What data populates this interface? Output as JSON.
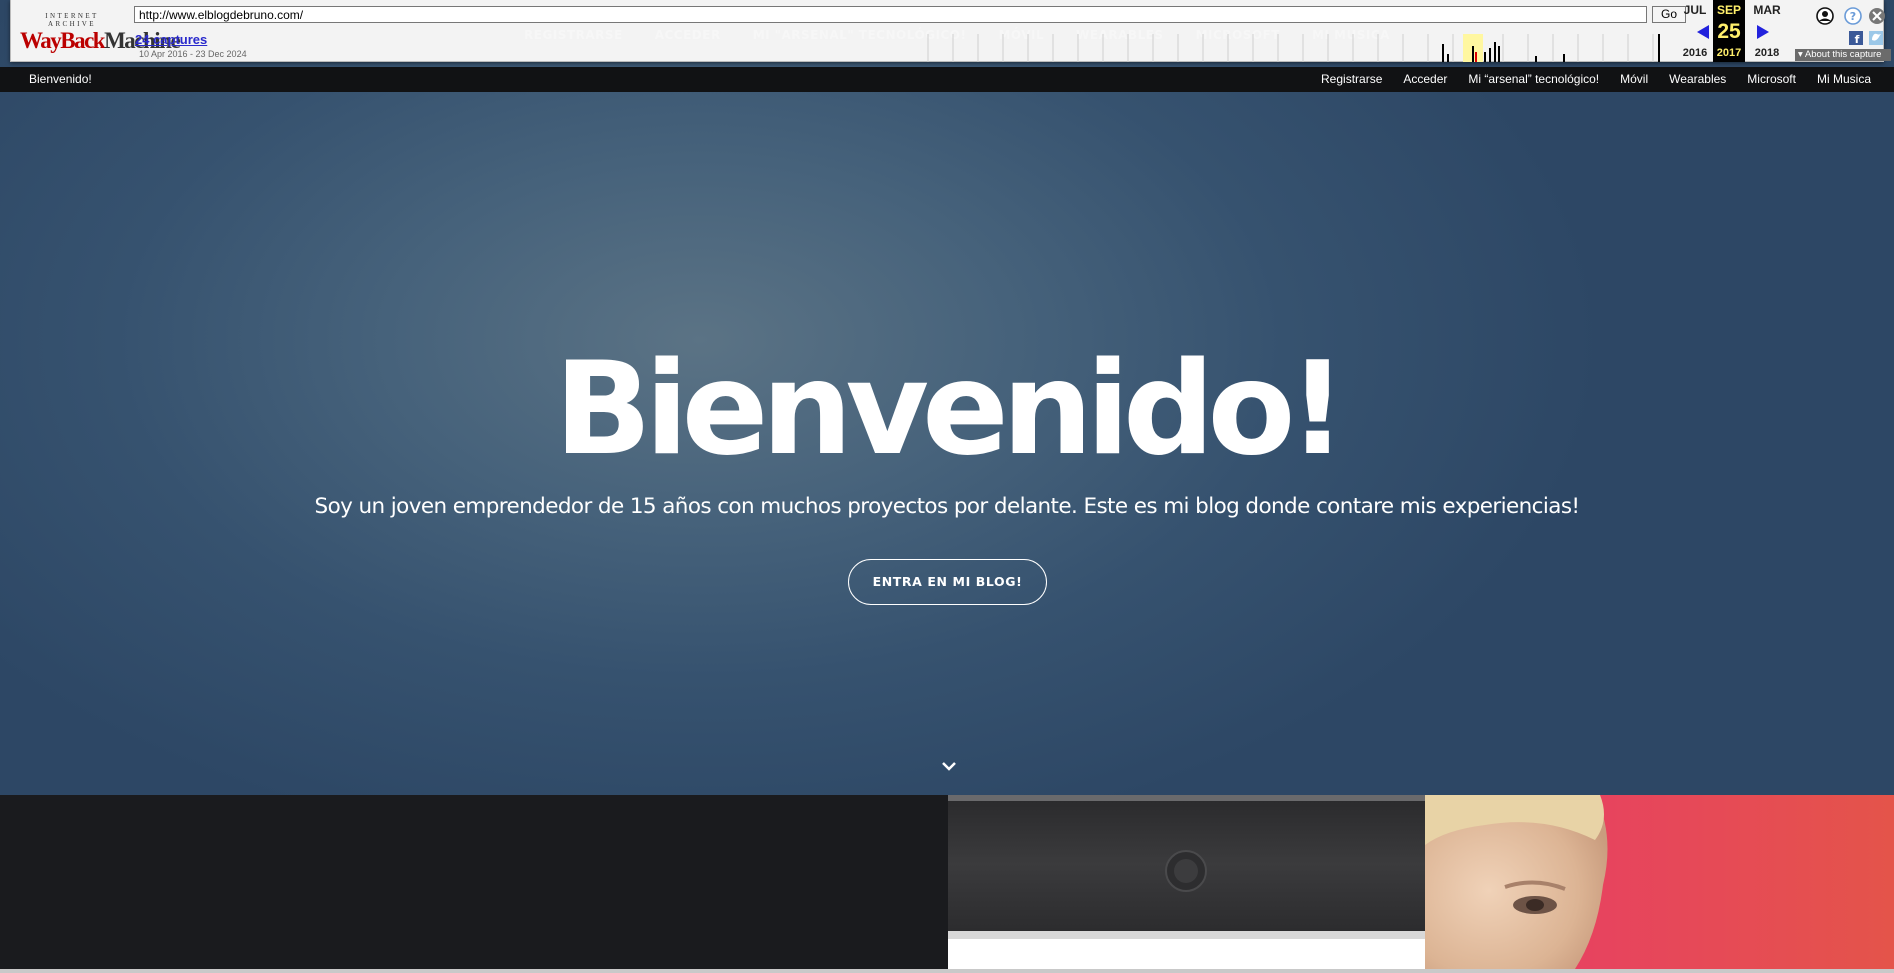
{
  "wayback": {
    "logo_top": "INTERNET ARCHIVE",
    "logo_wayback": "WayBack",
    "logo_machine": "Machine",
    "url": "http://www.elblogdebruno.com/",
    "go_label": "Go",
    "captures": "24 captures",
    "range": "10 Apr 2016 - 23 Dec 2024",
    "prev_month": "JUL",
    "prev_year": "2016",
    "cur_month": "SEP",
    "cur_day": "25",
    "cur_year": "2017",
    "next_month": "MAR",
    "next_year": "2018",
    "about": "About this capture",
    "ghost_nav": [
      "REGISTRARSE",
      "ACCEDER",
      "MI \"ARSENAL\" TECNOLÓGICO!",
      "MÓVIL",
      "WEARABLES",
      "MICROSOFT",
      "MI MUSICA"
    ],
    "icons": [
      "user-icon",
      "help-icon",
      "close-icon",
      "facebook-icon",
      "twitter-icon",
      "prev-arrow-icon",
      "next-arrow-icon"
    ],
    "colors": {
      "logo_red": "#bb0000",
      "link": "#2a2acc",
      "highlight": "#ffef6b",
      "arrow": "#2222dd"
    }
  },
  "site": {
    "brand": "Bienvenido!",
    "menu": [
      "Registrarse",
      "Acceder",
      "Mi “arsenal” tecnológico!",
      "Móvil",
      "Wearables",
      "Microsoft",
      "Mi Musica"
    ]
  },
  "hero": {
    "title": "Bienvenido!",
    "subtitle": "Soy un joven emprendedor de 15 años con muchos proyectos por delante.  Este es mi blog donde contare mis experiencias!",
    "button": "ENTRA EN MI  BLOG!",
    "scroll_icon": "chevron-down-icon",
    "colors": {
      "bg_center": "#5b7385",
      "bg_edge": "#2d4765"
    }
  }
}
